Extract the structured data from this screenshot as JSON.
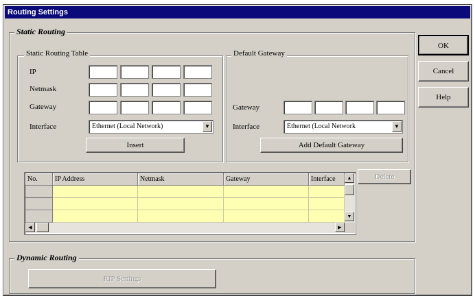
{
  "window": {
    "title": "Routing Settings"
  },
  "static_routing": {
    "title": "Static Routing",
    "table_group": {
      "title": "Static Routing Table",
      "ip_label": "IP",
      "netmask_label": "Netmask",
      "gateway_label": "Gateway",
      "interface_label": "Interface",
      "interface_value": "Ethernet (Local Network)",
      "insert_label": "Insert"
    },
    "default_gateway": {
      "title": "Default Gateway",
      "gateway_label": "Gateway",
      "interface_label": "Interface",
      "interface_value": "Ethernet (Local Network",
      "add_label": "Add Default Gateway"
    },
    "table": {
      "columns": [
        "No.",
        "IP Address",
        "Netmask",
        "Gateway",
        "Interface"
      ],
      "rows": 3
    },
    "delete_label": "Delete"
  },
  "dynamic_routing": {
    "title": "Dynamic Routing",
    "rip_label": "RIP Settings"
  },
  "buttons": {
    "ok": "OK",
    "cancel": "Cancel",
    "help": "Help"
  },
  "colors": {
    "title_bar": "#0a0a7a",
    "grid_cell": "#ffffb4",
    "face": "#d4d0c8"
  }
}
